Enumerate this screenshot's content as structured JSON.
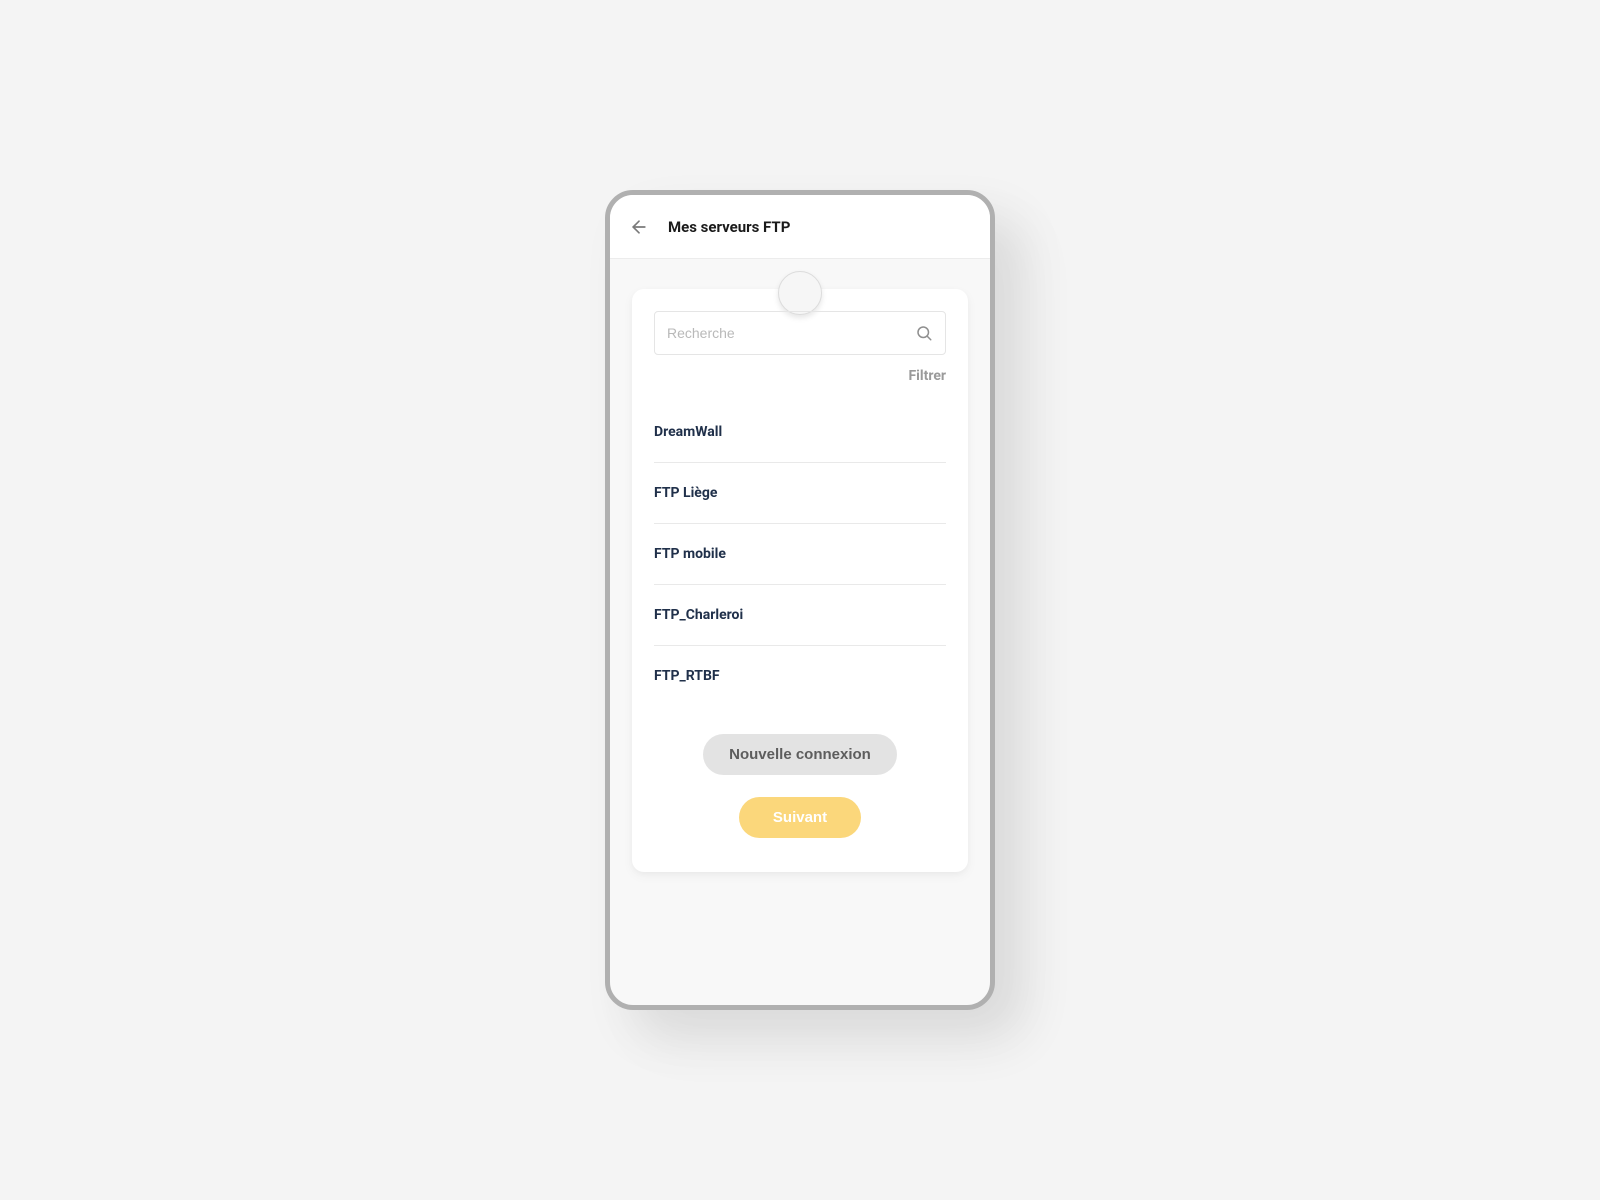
{
  "header": {
    "title": "Mes serveurs FTP"
  },
  "search": {
    "placeholder": "Recherche",
    "filter_label": "Filtrer"
  },
  "servers": [
    {
      "name": "DreamWall"
    },
    {
      "name": "FTP Liège"
    },
    {
      "name": "FTP mobile"
    },
    {
      "name": "FTP_Charleroi"
    },
    {
      "name": "FTP_RTBF"
    }
  ],
  "buttons": {
    "new_connection": "Nouvelle connexion",
    "next": "Suivant"
  }
}
